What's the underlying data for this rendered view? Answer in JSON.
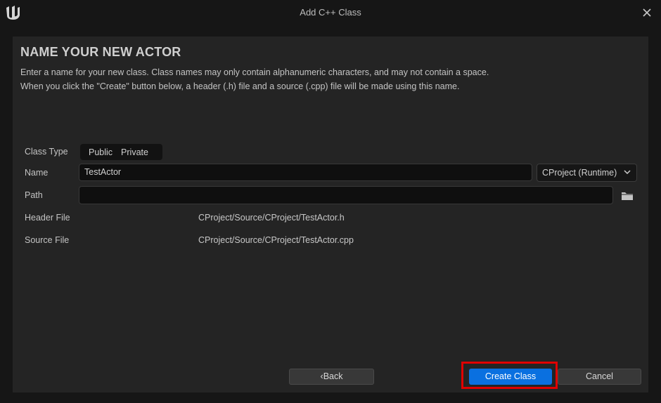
{
  "window": {
    "title": "Add C++ Class",
    "logo_icon": "unreal-logo-icon",
    "close_icon": "close-icon"
  },
  "page": {
    "heading": "NAME YOUR NEW ACTOR",
    "description_line1": "Enter a name for your new class. Class names may only contain alphanumeric characters, and may not contain a space.",
    "description_line2": "When you click the \"Create\" button below, a header (.h) file and a source (.cpp) file will be made using this name."
  },
  "form": {
    "class_type": {
      "label": "Class Type",
      "options": [
        "Public",
        "Private"
      ]
    },
    "name": {
      "label": "Name",
      "value": "TestActor",
      "module": "CProject (Runtime)"
    },
    "path": {
      "label": "Path",
      "value": "",
      "browse_icon": "folder-icon"
    },
    "header_file": {
      "label": "Header File",
      "value": "CProject/Source/CProject/TestActor.h"
    },
    "source_file": {
      "label": "Source File",
      "value": "CProject/Source/CProject/TestActor.cpp"
    }
  },
  "buttons": {
    "back": "Back",
    "create": "Create Class",
    "cancel": "Cancel"
  },
  "colors": {
    "accent": "#0a70e0",
    "highlight": "#e00000",
    "background": "#161616",
    "panel": "#242424"
  }
}
